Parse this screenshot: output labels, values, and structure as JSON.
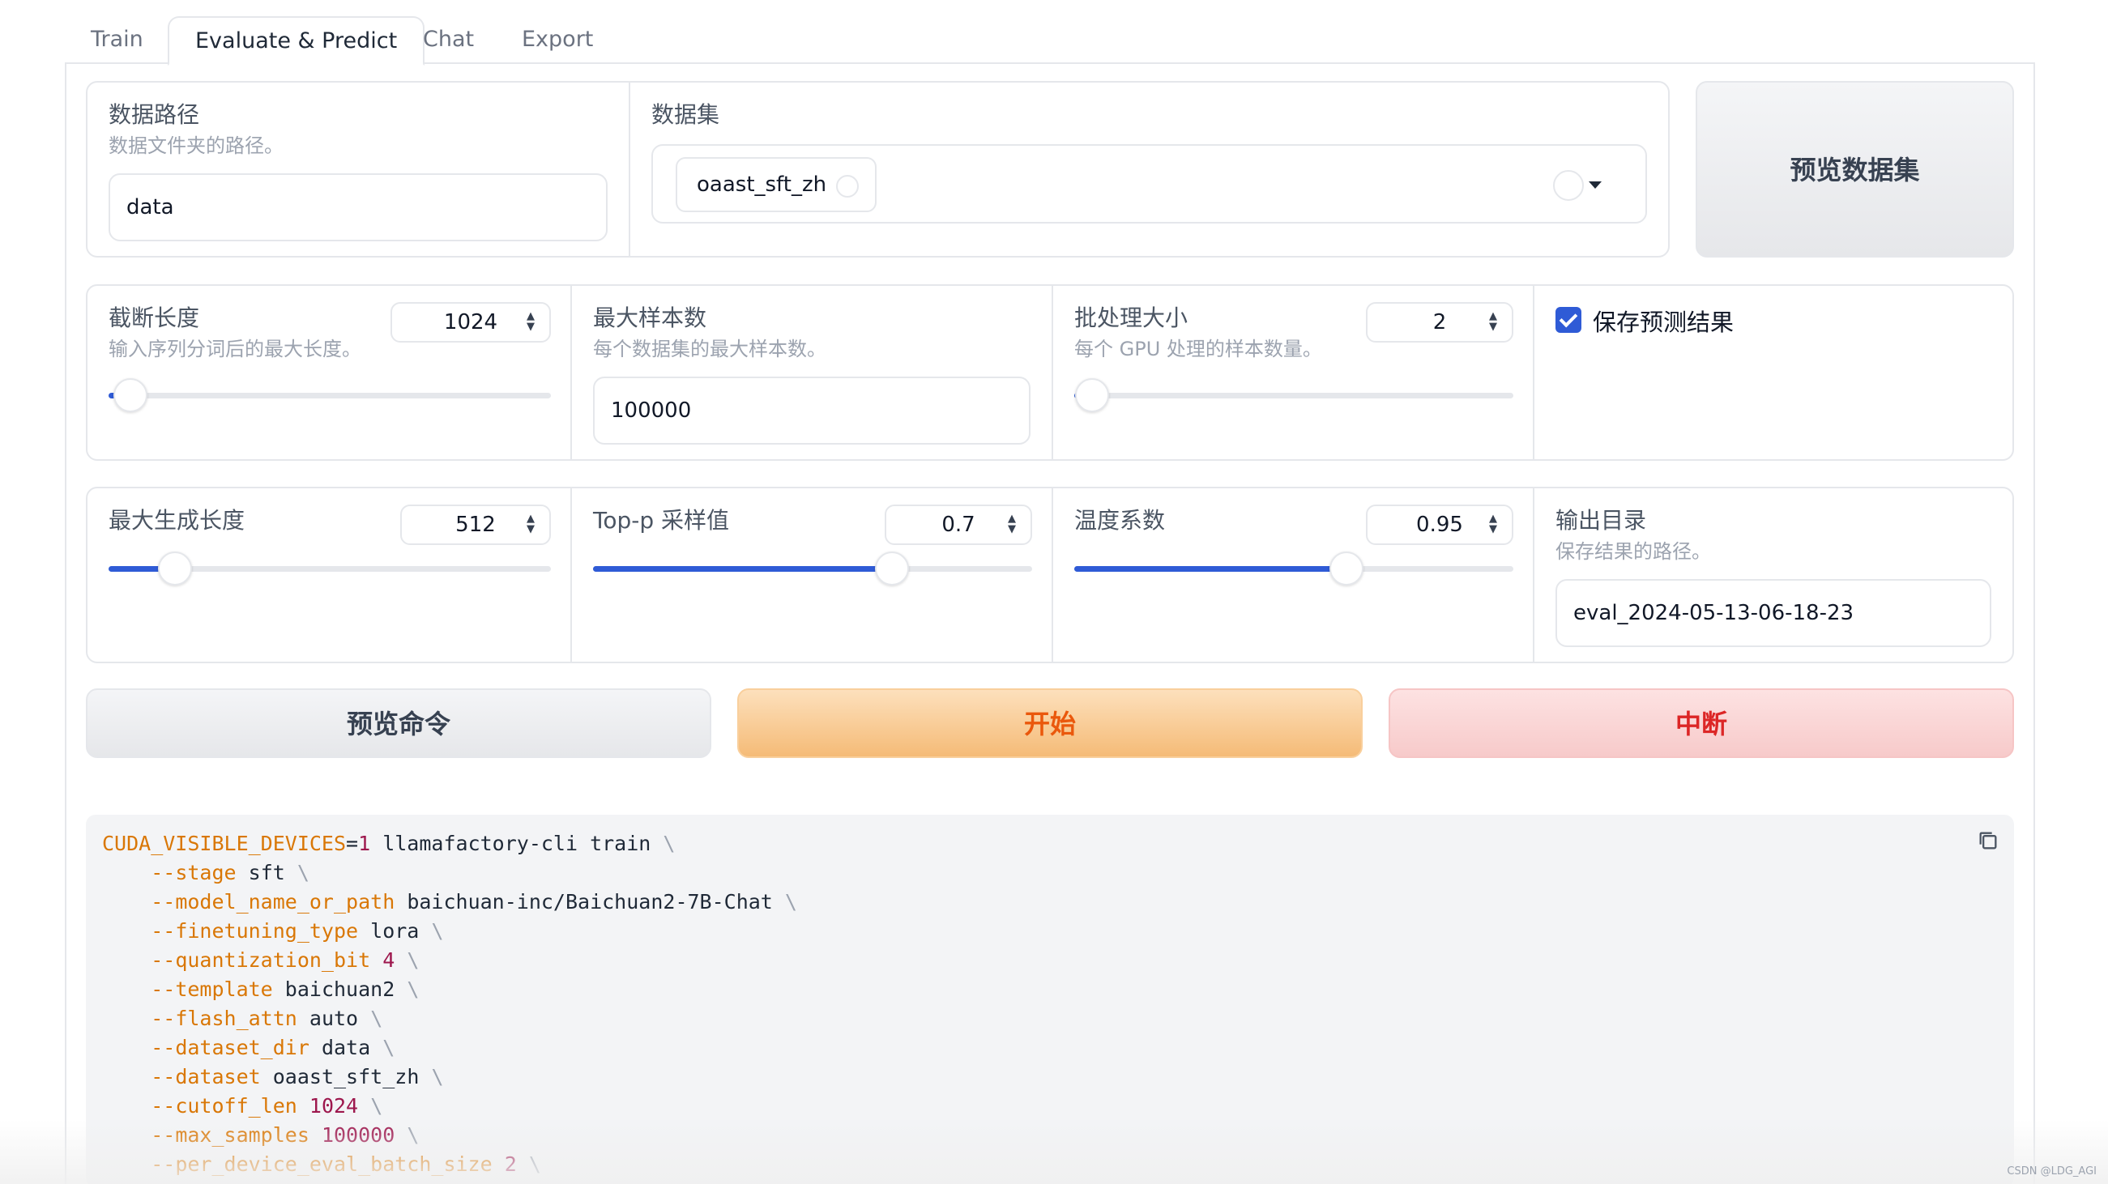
{
  "tabs": [
    "Train",
    "Evaluate & Predict",
    "Chat",
    "Export"
  ],
  "data_path": {
    "label": "数据路径",
    "info": "数据文件夹的路径。",
    "value": "data"
  },
  "dataset": {
    "label": "数据集",
    "selected": "oaast_sft_zh"
  },
  "preview_dataset": "预览数据集",
  "cutoff_len": {
    "label": "截断长度",
    "info": "输入序列分词后的最大长度。",
    "value": "1024",
    "fraction": 0.05
  },
  "max_samples": {
    "label": "最大样本数",
    "info": "每个数据集的最大样本数。",
    "value": "100000"
  },
  "batch_size": {
    "label": "批处理大小",
    "info": "每个 GPU 处理的样本数量。",
    "value": "2",
    "fraction": 0.04
  },
  "predict": {
    "label": "保存预测结果",
    "checked": true
  },
  "max_new_tokens": {
    "label": "最大生成长度",
    "value": "512",
    "fraction": 0.15
  },
  "top_p": {
    "label": "Top-p 采样值",
    "value": "0.7",
    "fraction": 0.68
  },
  "temperature": {
    "label": "温度系数",
    "value": "0.95",
    "fraction": 0.62
  },
  "output_dir": {
    "label": "输出目录",
    "info": "保存结果的路径。",
    "value": "eval_2024-05-13-06-18-23"
  },
  "buttons": {
    "preview_cmd": "预览命令",
    "start": "开始",
    "stop": "中断"
  },
  "command": {
    "head": {
      "var": "CUDA_VISIBLE_DEVICES",
      "eq": "=",
      "val": "1",
      "rest": " llamafactory-cli train "
    },
    "args": [
      {
        "flag": "--stage",
        "value": "sft",
        "numeric": false
      },
      {
        "flag": "--model_name_or_path",
        "value": "baichuan-inc/Baichuan2-7B-Chat",
        "numeric": false
      },
      {
        "flag": "--finetuning_type",
        "value": "lora",
        "numeric": false
      },
      {
        "flag": "--quantization_bit",
        "value": "4",
        "numeric": true
      },
      {
        "flag": "--template",
        "value": "baichuan2",
        "numeric": false
      },
      {
        "flag": "--flash_attn",
        "value": "auto",
        "numeric": false
      },
      {
        "flag": "--dataset_dir",
        "value": "data",
        "numeric": false
      },
      {
        "flag": "--dataset",
        "value": "oaast_sft_zh",
        "numeric": false
      },
      {
        "flag": "--cutoff_len",
        "value": "1024",
        "numeric": true
      },
      {
        "flag": "--max_samples",
        "value": "100000",
        "numeric": true
      },
      {
        "flag": "--per_device_eval_batch_size",
        "value": "2",
        "numeric": true
      }
    ]
  },
  "watermark": "CSDN @LDG_AGI",
  "colors": {
    "accent": "#2f5bd6",
    "start_text": "#ea580c",
    "stop_text": "#dc2626",
    "flag": "#d97706",
    "number": "#9d174d"
  }
}
